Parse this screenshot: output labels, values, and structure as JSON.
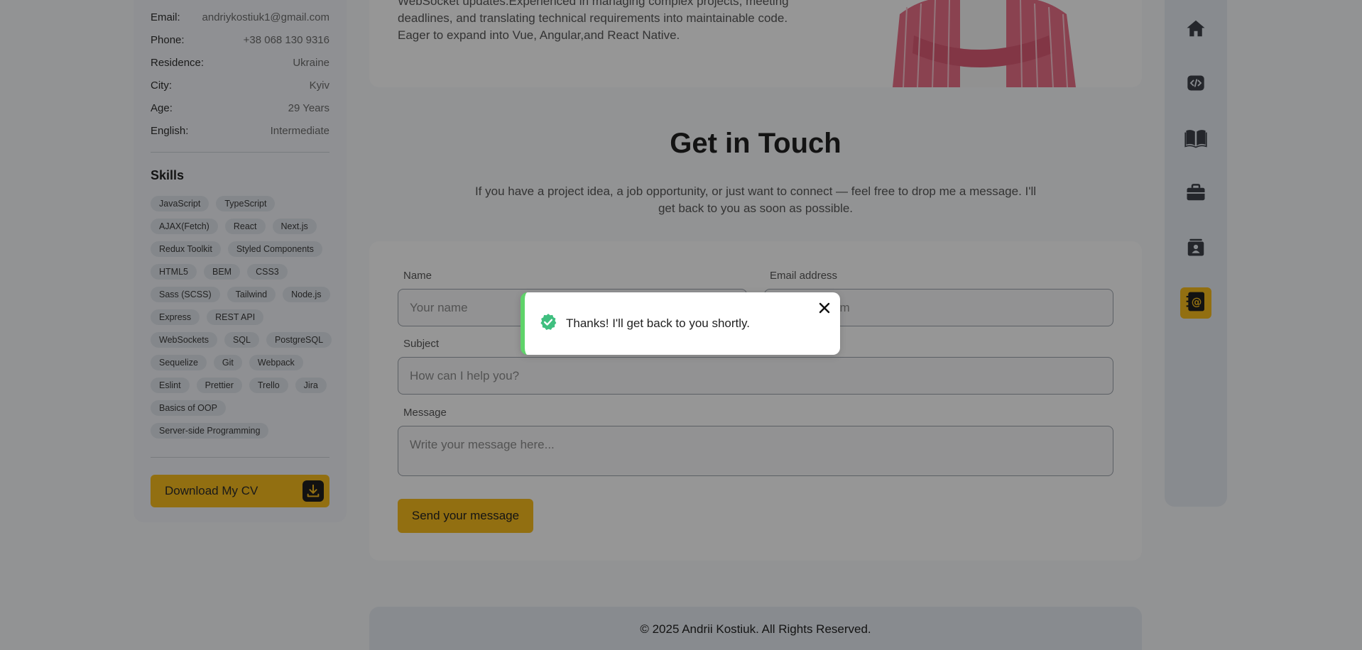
{
  "sidebar": {
    "info": [
      {
        "key": "Email:",
        "value": "andriykostiuk1@gmail.com"
      },
      {
        "key": "Phone:",
        "value": "+38 068 130 9316"
      },
      {
        "key": "Residence:",
        "value": "Ukraine"
      },
      {
        "key": "City:",
        "value": "Kyiv"
      },
      {
        "key": "Age:",
        "value": "29 Years"
      },
      {
        "key": "English:",
        "value": "Intermediate"
      }
    ],
    "skills_title": "Skills",
    "skills": [
      "JavaScript",
      "TypeScript",
      "AJAX(Fetch)",
      "React",
      "Next.js",
      "Redux Toolkit",
      "Styled Components",
      "HTML5",
      "BEM",
      "CSS3",
      "Sass (SCSS)",
      "Tailwind",
      "Node.js",
      "Express",
      "REST API",
      "WebSockets",
      "SQL",
      "PostgreSQL",
      "Sequelize",
      "Git",
      "Webpack",
      "Eslint",
      "Prettier",
      "Trello",
      "Jira",
      "Basics of OOP",
      "Server-side Programming"
    ],
    "download_label": "Download My CV"
  },
  "bio": {
    "line1": "WebSocket updates.Experienced in managing complex projects, meeting",
    "line2": "deadlines, and translating technical requirements into maintainable code.",
    "line3": "Eager to expand into Vue, Angular,and React Native."
  },
  "contact": {
    "title": "Get in Touch",
    "lead": "If you have a project idea, a job opportunity, or just want to connect — feel free to drop me a message. I'll get back to you as soon as possible.",
    "name_label": "Name",
    "name_placeholder": "Your name",
    "email_label": "Email address",
    "email_placeholder_visible": "om",
    "subject_label": "Subject",
    "subject_placeholder": "How can I help you?",
    "message_label": "Message",
    "message_placeholder": "Write your message here...",
    "send_label": "Send your message"
  },
  "footer": {
    "text": "© 2025 Andrii Kostiuk. All Rights Reserved."
  },
  "nav": {
    "items": [
      "home-icon",
      "code-icon",
      "book-icon",
      "briefcase-icon",
      "contact-card-icon",
      "address-book-icon"
    ],
    "active": "address-book-icon"
  },
  "toast": {
    "message": "Thanks! I'll get back to you shortly."
  },
  "colors": {
    "accent": "#f4b91d",
    "success": "#5fd36a"
  }
}
